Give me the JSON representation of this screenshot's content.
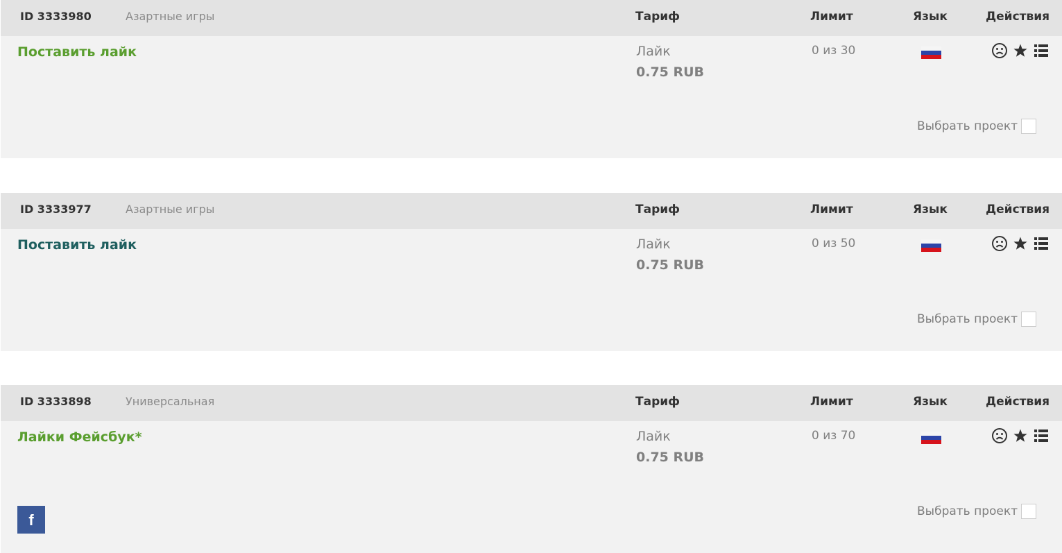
{
  "columns": {
    "tariff": "Тариф",
    "limit": "Лимит",
    "language": "Язык",
    "actions": "Действия"
  },
  "select_label": "Выбрать проект",
  "projects": [
    {
      "id": "ID 3333980",
      "category": "Азартные игры",
      "title": "Поставить лайк",
      "title_color": "#5a9e2f",
      "tariff_name": "Лайк",
      "tariff_price": "0.75 RUB",
      "limit": "0 из 30",
      "language_flag": "russia-flag",
      "has_facebook_icon": false
    },
    {
      "id": "ID 3333977",
      "category": "Азартные игры",
      "title": "Поставить лайк",
      "title_color": "#1f5f5f",
      "tariff_name": "Лайк",
      "tariff_price": "0.75 RUB",
      "limit": "0 из 50",
      "language_flag": "russia-flag",
      "has_facebook_icon": false
    },
    {
      "id": "ID 3333898",
      "category": "Универсальная",
      "title": "Лайки Фейсбук*",
      "title_color": "#5a9e2f",
      "tariff_name": "Лайк",
      "tariff_price": "0.75 RUB",
      "limit": "0 из 70",
      "language_flag": "russia-flag",
      "has_facebook_icon": true,
      "facebook_icon_text": "f"
    }
  ],
  "action_icons": [
    "sad-face-icon",
    "star-icon",
    "list-icon"
  ],
  "colors": {
    "header_bg": "#e3e3e3",
    "body_bg": "#f2f2f2",
    "facebook_blue": "#3b5998"
  }
}
